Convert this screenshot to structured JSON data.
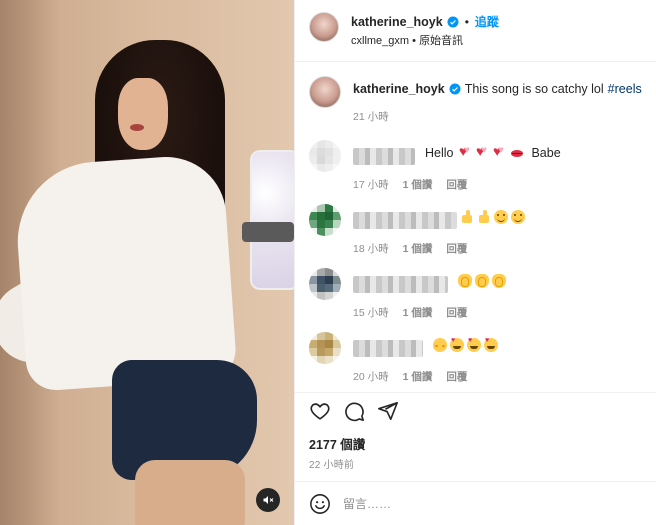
{
  "header": {
    "username": "katherine_hoyk",
    "separator": "•",
    "follow_label": "追蹤",
    "audio_user": "cxllme_gxm",
    "audio_label": "原始音訊",
    "verified_icon": "verified-badge-icon"
  },
  "caption": {
    "username": "katherine_hoyk",
    "text": "This song is so catchy lol",
    "hashtag": "#reels",
    "time": "21 小時"
  },
  "comments": [
    {
      "text": "Hello",
      "trailing": "Babe",
      "emojis": [
        "hearts",
        "hearts",
        "hearts",
        "kiss"
      ],
      "time": "17 小時",
      "likes": "1 個讚",
      "reply": "回覆"
    },
    {
      "text": "",
      "trailing": "",
      "emojis": [
        "thumb",
        "thumb",
        "smile",
        "smile"
      ],
      "time": "18 小時",
      "likes": "1 個讚",
      "reply": "回覆"
    },
    {
      "text": "",
      "trailing": "",
      "emojis": [
        "clap",
        "clap",
        "clap"
      ],
      "time": "15 小時",
      "likes": "1 個讚",
      "reply": "回覆"
    },
    {
      "text": "",
      "trailing": "",
      "emojis": [
        "flushed",
        "hearteyes",
        "hearteyes",
        "hearteyes"
      ],
      "time": "20 小時",
      "likes": "1 個讚",
      "reply": "回覆"
    }
  ],
  "actions": {
    "like_icon": "heart-icon",
    "comment_icon": "comment-icon",
    "share_icon": "share-icon"
  },
  "likes": "2177 個讚",
  "post_time": "22 小時前",
  "comment_box": {
    "placeholder": "留言……",
    "emoji_icon": "emoji-icon"
  },
  "media": {
    "mute_icon": "muted-speaker-icon"
  },
  "colors": {
    "link_blue": "#0095f6",
    "hashtag": "#00376b",
    "muted_text": "#8e8e8e",
    "text": "#262626"
  }
}
